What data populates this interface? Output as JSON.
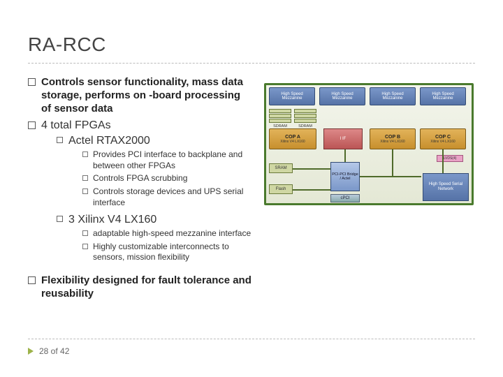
{
  "title": "RA-RCC",
  "bullets": {
    "b1": "Controls sensor functionality, mass data storage,  performs on -board processing of sensor data",
    "b2": "4 total FPGAs",
    "b2_1": "Actel RTAX2000",
    "b2_1_1": "Provides PCI interface to backplane and between other FPGAs",
    "b2_1_2": "Controls FPGA scrubbing",
    "b2_1_3": "Controls storage devices and UPS serial interface",
    "b2_2": "3 Xilinx V4 LX160",
    "b2_2_1": "adaptable high-speed mezzanine interface",
    "b2_2_2": "Highly customizable interconnects to sensors, mission flexibility",
    "b3": "Flexibility designed for fault tolerance and reusability"
  },
  "diagram": {
    "hs": "High Speed",
    "mezz": "Mezzanine",
    "sdram": "SDRAM",
    "xv4": "Xilinx V4 LX160",
    "copA": "COP A",
    "copB": "COP B",
    "copC": "COP C",
    "iif": "I IF",
    "lv": "LVDS(4)",
    "sram": "SRAM",
    "flash": "Flash",
    "bridge": "PCI-PCI Bridge / Actel",
    "cpci": "cPCI",
    "hsn": "High Speed Serial Network"
  },
  "footer": {
    "page": "28 of 42"
  }
}
